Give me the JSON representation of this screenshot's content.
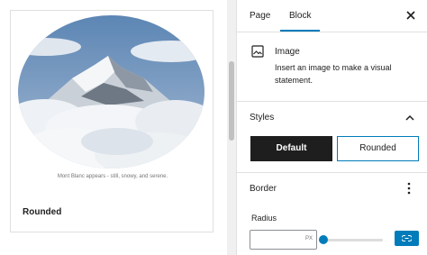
{
  "canvas": {
    "caption": "Mont Blanc appears - still, snowy, and serene.",
    "style_label": "Rounded"
  },
  "sidebar": {
    "tabs": [
      {
        "label": "Page"
      },
      {
        "label": "Block"
      }
    ],
    "active_tab": "Block",
    "block": {
      "icon": "image-icon",
      "title": "Image",
      "description": "Insert an image to make a visual statement."
    },
    "styles": {
      "title": "Styles",
      "options": [
        {
          "label": "Default",
          "selected": true
        },
        {
          "label": "Rounded",
          "selected": false
        }
      ]
    },
    "border": {
      "title": "Border",
      "radius_label": "Radius",
      "radius_value": "",
      "unit": "PX",
      "slider_value": 0
    }
  },
  "colors": {
    "accent": "#007cba",
    "dark": "#1e1e1e",
    "border": "#e0e0e0"
  }
}
